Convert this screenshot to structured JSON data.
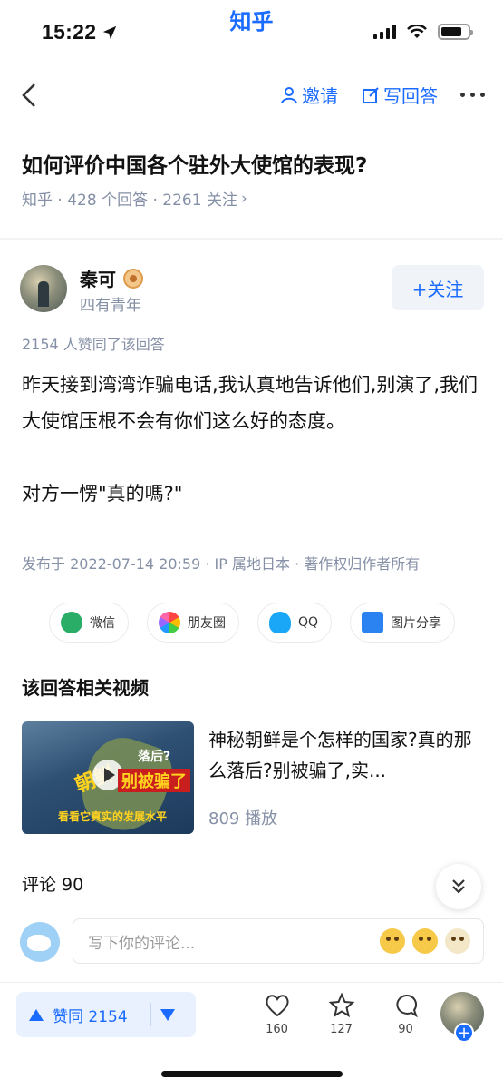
{
  "status_bar": {
    "time": "15:22",
    "carrier": "知乎"
  },
  "nav": {
    "invite_label": "邀请",
    "write_answer_label": "写回答"
  },
  "question": {
    "title": "如何评价中国各个驻外大使馆的表现?",
    "meta": "知乎 · 428 个回答 · 2261 关注"
  },
  "author": {
    "name": "秦可",
    "bio": "四有青年",
    "follow_label": "+关注"
  },
  "answer": {
    "votes_line": "2154 人赞同了该回答",
    "paragraph1": "昨天接到湾湾诈骗电话,我认真地告诉他们,别演了,我们大使馆压根不会有你们这么好的态度。",
    "paragraph2": "对方一愣\"真的嗎?\"",
    "published": "发布于 2022-07-14 20:59 · IP 属地日本 · 著作权归作者所有"
  },
  "share": {
    "wechat": "微信",
    "moments": "朋友圈",
    "qq": "QQ",
    "picture": "图片分享"
  },
  "related": {
    "heading": "该回答相关视频",
    "video_title": "神秘朝鲜是个怎样的国家?真的那么落后?别被骗了,实...",
    "plays": "809 播放",
    "thumb_text_1": "落后?",
    "thumb_text_2": "别被骗了",
    "thumb_text_3": "看看它真实的发展水平",
    "thumb_text_4": "朝鲜"
  },
  "comments": {
    "heading": "评论 90",
    "placeholder": "写下你的评论..."
  },
  "bottom_bar": {
    "vote_label": "赞同 2154",
    "likes": "160",
    "favorites": "127",
    "comments": "90"
  },
  "colors": {
    "accent": "#1a6bff",
    "muted": "#8590a6"
  }
}
